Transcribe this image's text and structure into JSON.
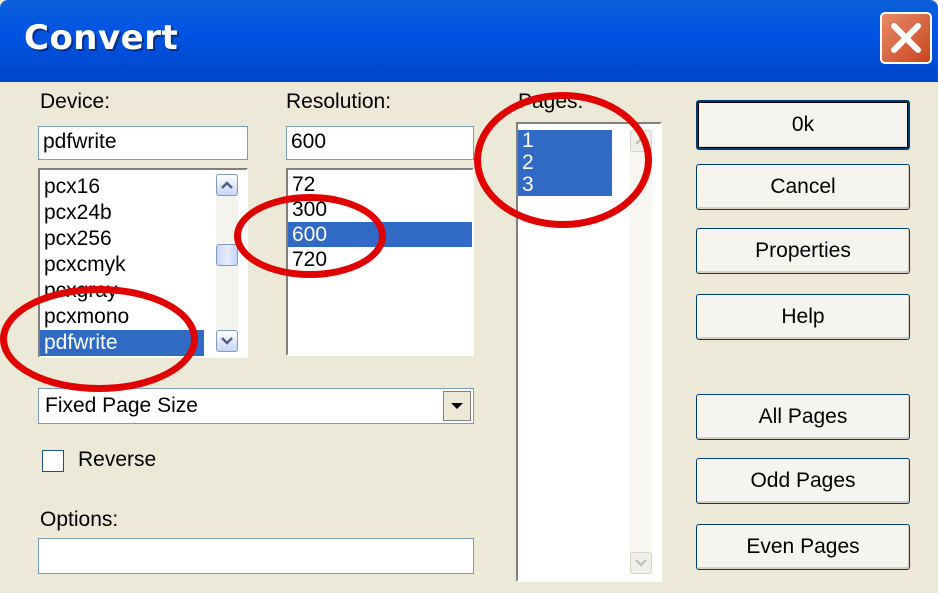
{
  "window": {
    "title": "Convert"
  },
  "device": {
    "label": "Device:",
    "value": "pdfwrite",
    "items": [
      "pcx16",
      "pcx24b",
      "pcx256",
      "pcxcmyk",
      "pcxgray",
      "pcxmono",
      "pdfwrite"
    ],
    "selected": "pdfwrite"
  },
  "resolution": {
    "label": "Resolution:",
    "value": "600",
    "items": [
      "72",
      "300",
      "600",
      "720"
    ],
    "selected": "600"
  },
  "pages": {
    "label": "Pages:",
    "items": [
      "1",
      "2",
      "3"
    ],
    "selected": [
      "1",
      "2",
      "3"
    ]
  },
  "page_size": {
    "value": "Fixed Page Size"
  },
  "reverse": {
    "label": "Reverse",
    "checked": false
  },
  "options": {
    "label": "Options:",
    "value": ""
  },
  "buttons": {
    "ok": "0k",
    "cancel": "Cancel",
    "properties": "Properties",
    "help": "Help",
    "all_pages": "All Pages",
    "odd_pages": "Odd Pages",
    "even_pages": "Even Pages"
  },
  "colors": {
    "titlebar": "#0054e3",
    "selection": "#316ac5",
    "annotation": "#e00000",
    "close": "#c8461e"
  }
}
